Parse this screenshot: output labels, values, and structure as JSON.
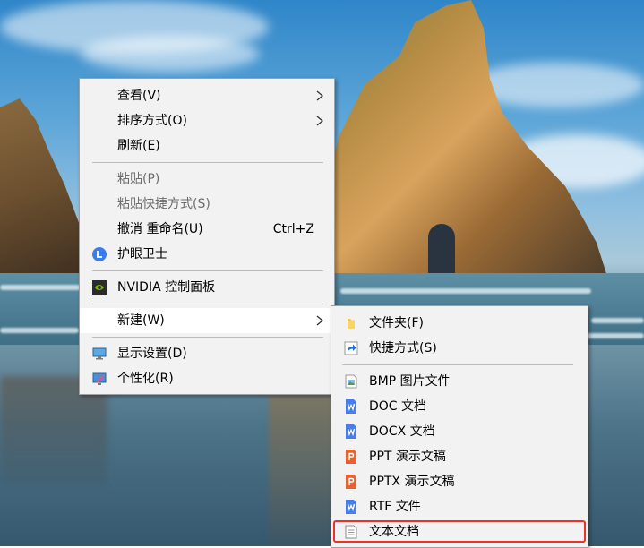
{
  "context_menu": {
    "items": [
      {
        "label": "查看(V)"
      },
      {
        "label": "排序方式(O)"
      },
      {
        "label": "刷新(E)"
      },
      {
        "label": "粘贴(P)"
      },
      {
        "label": "粘贴快捷方式(S)"
      },
      {
        "label": "撤消 重命名(U)",
        "shortcut": "Ctrl+Z"
      },
      {
        "label": "护眼卫士"
      },
      {
        "label": "NVIDIA 控制面板"
      },
      {
        "label": "新建(W)"
      },
      {
        "label": "显示设置(D)"
      },
      {
        "label": "个性化(R)"
      }
    ]
  },
  "new_submenu": {
    "items": [
      {
        "label": "文件夹(F)",
        "icon": "folder-icon"
      },
      {
        "label": "快捷方式(S)",
        "icon": "shortcut-icon"
      },
      {
        "label": "BMP 图片文件",
        "icon": "bmp-file-icon"
      },
      {
        "label": "DOC 文档",
        "icon": "word-doc-icon"
      },
      {
        "label": "DOCX 文档",
        "icon": "word-docx-icon"
      },
      {
        "label": "PPT 演示文稿",
        "icon": "ppt-icon"
      },
      {
        "label": "PPTX 演示文稿",
        "icon": "pptx-icon"
      },
      {
        "label": "RTF 文件",
        "icon": "rtf-icon"
      },
      {
        "label": "文本文档",
        "icon": "text-document-icon"
      }
    ]
  },
  "colors": {
    "menu_bg": "#f2f2f2",
    "hover_bg": "#ffffff",
    "disabled_text": "#6d6d6d",
    "highlight_border": "#e8322b",
    "wps_word_blue": "#4a7ee6",
    "wps_ppt_orange": "#e8622f",
    "folder_yellow": "#f0c24b"
  }
}
